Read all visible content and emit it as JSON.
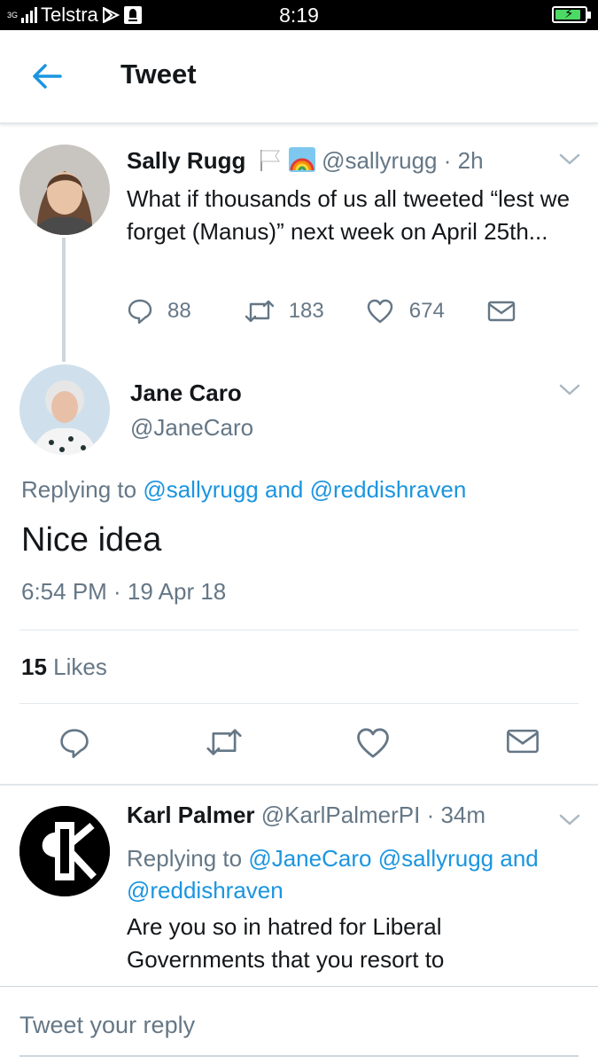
{
  "status_bar": {
    "network": "3G",
    "carrier": "Telstra",
    "time": "8:19"
  },
  "header": {
    "title": "Tweet",
    "back_icon": "arrow-left-icon"
  },
  "colors": {
    "accent": "#1b95e0",
    "secondary_text": "#657786",
    "primary_text": "#14171a",
    "divider": "#e1e8ed"
  },
  "parent_tweet": {
    "name": "Sally Rugg",
    "handle": "@sallyrugg",
    "time_ago": "· 2h",
    "emoji": [
      "white-flag-icon",
      "rainbow-icon"
    ],
    "text": "What if thousands of us all tweeted “lest we forget (Manus)” next week on April 25th...",
    "reply_count": "88",
    "retweet_count": "183",
    "like_count": "674"
  },
  "main_tweet": {
    "name": "Jane Caro",
    "handle": "@JaneCaro",
    "replying_prefix": "Replying to",
    "replying_user1": "@sallyrugg",
    "replying_and": "and",
    "replying_user2": "@reddishraven",
    "text": "Nice idea",
    "timestamp": "6:54 PM · 19 Apr 18",
    "likes_count": "15",
    "likes_label": "Likes"
  },
  "reply_tweet": {
    "name": "Karl Palmer",
    "handle": "@KarlPalmerPI",
    "time_ago": "· 34m",
    "replying_prefix": "Replying to",
    "replying_user1": "@JaneCaro",
    "replying_user2": "@sallyrugg",
    "replying_and": "and",
    "replying_user3": "@reddishraven",
    "text": "Are you so in hatred for Liberal Governments that you resort to"
  },
  "composer": {
    "placeholder": "Tweet your reply"
  }
}
